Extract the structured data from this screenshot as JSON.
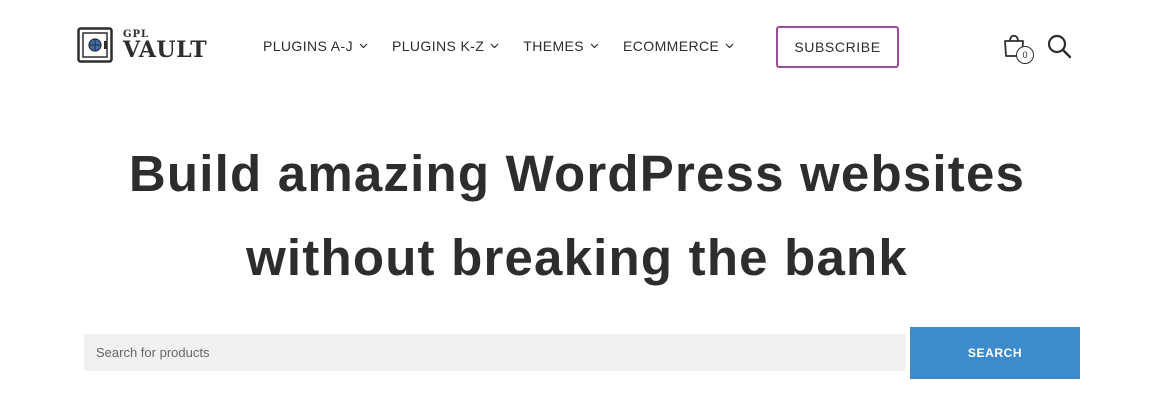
{
  "brand": {
    "small": "GPL",
    "big": "VAULT"
  },
  "nav": {
    "items": [
      {
        "label": "PLUGINS A-J"
      },
      {
        "label": "PLUGINS K-Z"
      },
      {
        "label": "THEMES"
      },
      {
        "label": "ECOMMERCE"
      }
    ],
    "subscribe_label": "SUBSCRIBE"
  },
  "cart": {
    "count": "0",
    "icon": "shopping-bag-icon"
  },
  "search_icon": "magnifier-icon",
  "hero": {
    "line1": "Build amazing WordPress websites",
    "line2": "without breaking the bank"
  },
  "product_search": {
    "placeholder": "Search for products",
    "value": "",
    "button_label": "SEARCH"
  },
  "colors": {
    "text": "#2d2d2d",
    "subscribe_border": "#9b4f96",
    "search_button": "#3d8bcc",
    "search_field": "#f1f1f1"
  }
}
